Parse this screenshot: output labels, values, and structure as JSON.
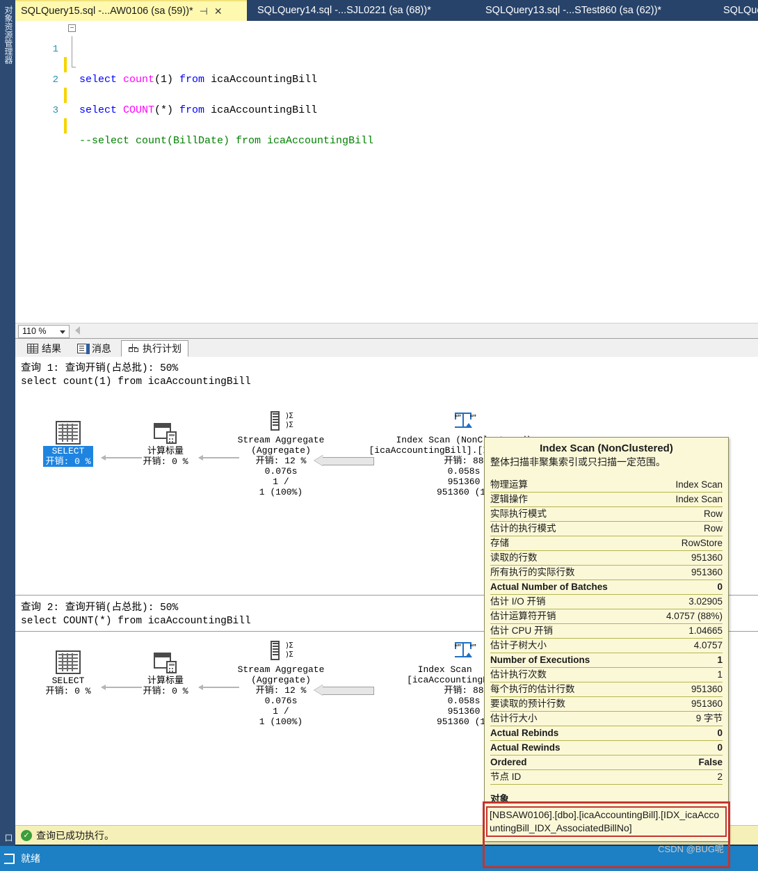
{
  "window": {
    "object_explorer_label": "对象资源管理器",
    "bottom_dock_label": "口"
  },
  "tabs": [
    {
      "title": "SQLQuery15.sql -...AW0106 (sa (59))*",
      "active": true,
      "pin": "⊣",
      "close": "✕"
    },
    {
      "title": "SQLQuery14.sql -...SJL0221 (sa (68))*",
      "active": false
    },
    {
      "title": "SQLQuery13.sql -...STest860 (sa (62))*",
      "active": false
    },
    {
      "title": "SQLQue",
      "active": false
    }
  ],
  "editor": {
    "lines": [
      {
        "num": "1",
        "segments": [
          {
            "t": "select ",
            "c": "kw"
          },
          {
            "t": "count",
            "c": "fn"
          },
          {
            "t": "(1) ",
            "c": "pl"
          },
          {
            "t": "from ",
            "c": "kw"
          },
          {
            "t": "icaAccountingBill",
            "c": "pl"
          }
        ]
      },
      {
        "num": "2",
        "segments": [
          {
            "t": "select ",
            "c": "kw"
          },
          {
            "t": "COUNT",
            "c": "fn"
          },
          {
            "t": "(*) ",
            "c": "pl"
          },
          {
            "t": "from ",
            "c": "kw"
          },
          {
            "t": "icaAccountingBill",
            "c": "pl"
          }
        ]
      },
      {
        "num": "3",
        "segments": [
          {
            "t": "--select count(BillDate) from icaAccountingBill",
            "c": "cmt"
          }
        ]
      }
    ],
    "fold_glyph": "−",
    "zoom_level": "110 %"
  },
  "result_tabs": [
    {
      "label": "结果",
      "icon": "grid-icon",
      "active": false
    },
    {
      "label": "消息",
      "icon": "message-icon",
      "active": false
    },
    {
      "label": "执行计划",
      "icon": "execution-plan-icon",
      "active": true
    }
  ],
  "plans": [
    {
      "header": "查询 1: 查询开销(占总批): 50%",
      "sql": "select count(1) from icaAccountingBill",
      "nodes": {
        "select": {
          "label": "SELECT",
          "cost": "开销: 0 %",
          "selected": true
        },
        "scalar": {
          "label": "计算标量",
          "cost": "开销: 0 %"
        },
        "aggregate": {
          "title": "Stream Aggregate",
          "subtitle": "(Aggregate)",
          "cost": "开销: 12 %",
          "time": "0.076s",
          "rows": "1 /",
          "rows2": "1 (100%)"
        },
        "scan": {
          "title": "Index Scan (NonClustered)",
          "subtitle": "[icaAccountingBill].[IDX_icaAccount",
          "cost": "开销: 88",
          "time": "0.058s",
          "rows": "951360",
          "rows2": "951360 (10"
        }
      }
    },
    {
      "header": "查询 2: 查询开销(占总批): 50%",
      "sql": "select COUNT(*) from icaAccountingBill",
      "nodes": {
        "select": {
          "label": "SELECT",
          "cost": "开销: 0 %",
          "selected": false
        },
        "scalar": {
          "label": "计算标量",
          "cost": "开销: 0 %"
        },
        "aggregate": {
          "title": "Stream Aggregate",
          "subtitle": "(Aggregate)",
          "cost": "开销: 12 %",
          "time": "0.076s",
          "rows": "1 /",
          "rows2": "1 (100%)"
        },
        "scan": {
          "title": "Index Scan  (Non(",
          "subtitle": "[icaAccountingBill].[",
          "cost": "开销: 88",
          "time": "0.058s",
          "rows": "951360",
          "rows2": "951360 (1("
        }
      }
    }
  ],
  "tooltip": {
    "title": "Index Scan (NonClustered)",
    "description": "整体扫描非聚集索引或只扫描一定范围。",
    "rows": [
      {
        "key": "物理运算",
        "value": "Index Scan",
        "bold": false
      },
      {
        "key": "逻辑操作",
        "value": "Index Scan",
        "bold": false
      },
      {
        "key": "实际执行模式",
        "value": "Row",
        "bold": false
      },
      {
        "key": "估计的执行模式",
        "value": "Row",
        "bold": false
      },
      {
        "key": "存储",
        "value": "RowStore",
        "bold": false
      },
      {
        "key": "读取的行数",
        "value": "951360",
        "bold": false
      },
      {
        "key": "所有执行的实际行数",
        "value": "951360",
        "bold": false
      },
      {
        "key": "Actual Number of Batches",
        "value": "0",
        "bold": true
      },
      {
        "key": "估计 I/O 开销",
        "value": "3.02905",
        "bold": false
      },
      {
        "key": "估计运算符开销",
        "value": "4.0757 (88%)",
        "bold": false
      },
      {
        "key": "估计 CPU 开销",
        "value": "1.04665",
        "bold": false
      },
      {
        "key": "估计子树大小",
        "value": "4.0757",
        "bold": false
      },
      {
        "key": "Number of Executions",
        "value": "1",
        "bold": true
      },
      {
        "key": "估计执行次数",
        "value": "1",
        "bold": false
      },
      {
        "key": "每个执行的估计行数",
        "value": "951360",
        "bold": false
      },
      {
        "key": "要读取的预计行数",
        "value": "951360",
        "bold": false
      },
      {
        "key": "估计行大小",
        "value": "9 字节",
        "bold": false
      },
      {
        "key": "Actual Rebinds",
        "value": "0",
        "bold": true
      },
      {
        "key": "Actual Rewinds",
        "value": "0",
        "bold": true
      },
      {
        "key": "Ordered",
        "value": "False",
        "bold": true
      },
      {
        "key": "节点 ID",
        "value": "2",
        "bold": false
      }
    ],
    "object_section_label": "对象",
    "object_value": "[NBSAW0106].[dbo].[icaAccountingBill].[IDX_icaAccountingBill_IDX_AssociatedBillNo]"
  },
  "success_bar": {
    "icon": "check-icon",
    "text": "查询已成功执行。"
  },
  "status_bar": {
    "text": "就绪"
  },
  "watermark": "CSDN @BUG呢",
  "colors": {
    "accent_blue": "#1d7fc4",
    "tab_active": "#fff9b0",
    "tooltip_bg": "#fbf8d8",
    "highlight_red": "#c2352f",
    "select_highlight": "#1f84e0"
  }
}
